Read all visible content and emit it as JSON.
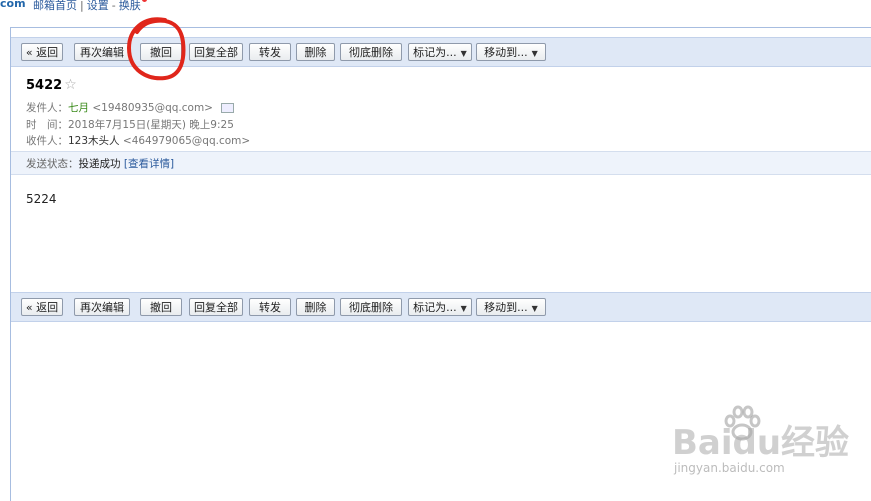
{
  "topnav": {
    "logo_fragment": "com",
    "links": [
      "邮箱首页",
      "设置",
      "换肤"
    ],
    "separator_1": "|",
    "separator_2": "-"
  },
  "toolbar": {
    "buttons": [
      {
        "label": "« 返回"
      },
      {
        "label": "再次编辑"
      },
      {
        "label": "撤回"
      },
      {
        "label": "回复全部"
      },
      {
        "label": "转发"
      },
      {
        "label": "删除"
      },
      {
        "label": "彻底删除"
      },
      {
        "label": "标记为..."
      },
      {
        "label": "移动到..."
      }
    ]
  },
  "mail": {
    "subject": "5422",
    "star": "☆",
    "from_label": "发件人：",
    "from_name": "七月",
    "from_email": "<19480935@qq.com>",
    "time_label": "时　间：",
    "time_value": "2018年7月15日(星期天) 晚上9:25",
    "to_label": "收件人：",
    "to_name": "123木头人",
    "to_email": "<464979065@qq.com>",
    "status_label": "发送状态：",
    "status_value": "投递成功",
    "status_link": "[查看详情]",
    "body": "5224"
  },
  "watermark": {
    "brand": "Baidu经验",
    "url": "jingyan.baidu.com"
  },
  "colors": {
    "toolbar_bg": "#dfe8f6",
    "sender_name": "#3a8a1a",
    "link": "#2b5a9c",
    "annotation": "#e0261b"
  }
}
